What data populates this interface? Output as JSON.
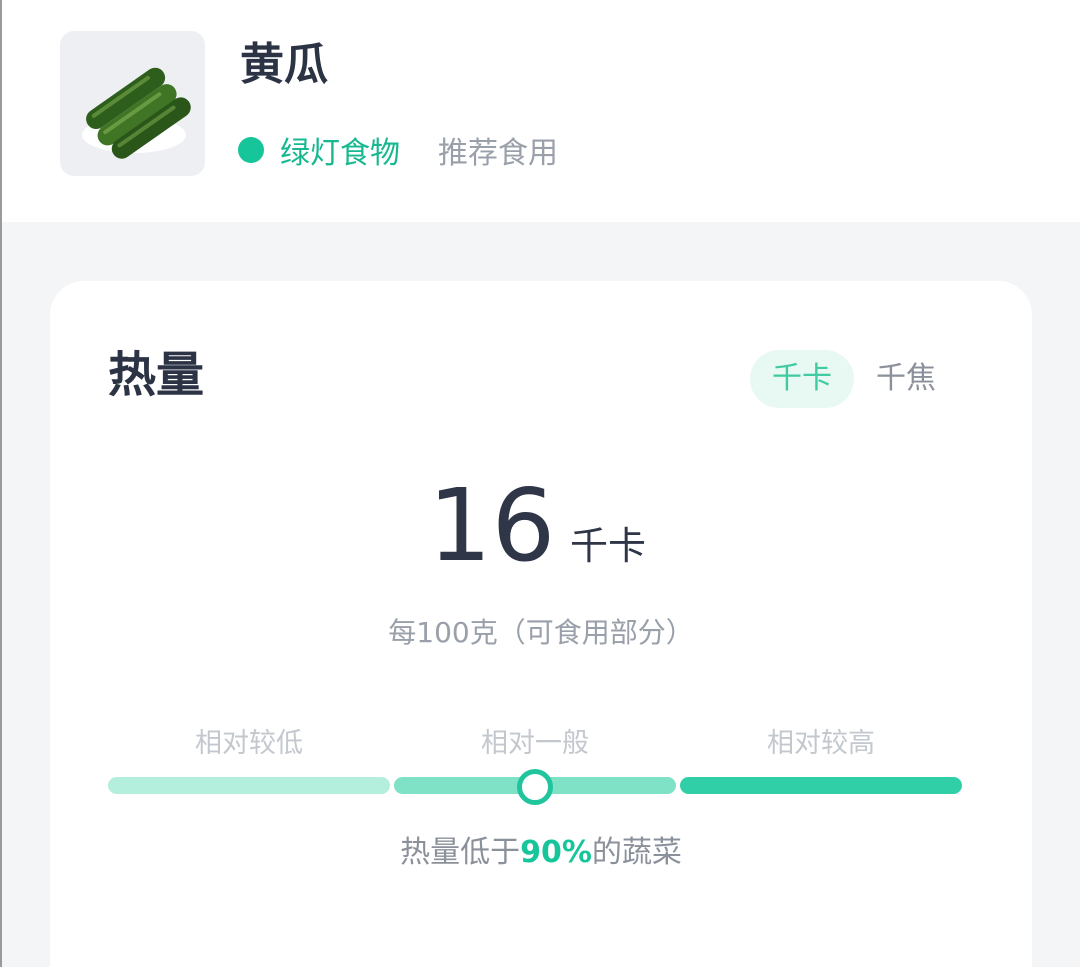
{
  "food": {
    "name": "黄瓜",
    "image_icon": "cucumber-photo",
    "tag_label": "绿灯食物",
    "tag_desc": "推荐食用",
    "tag_color": "#17c59a"
  },
  "energy": {
    "title": "热量",
    "units": [
      {
        "label": "千卡",
        "active": true
      },
      {
        "label": "千焦",
        "active": false
      }
    ],
    "value": "16",
    "unit_label": "千卡",
    "per_note": "每100克（可食用部分）",
    "levels": [
      {
        "label": "相对较低",
        "color": "#b4eedd"
      },
      {
        "label": "相对一般",
        "color": "#7fe1c5"
      },
      {
        "label": "相对较高",
        "color": "#31cfa7"
      }
    ],
    "marker_position_fraction": 0.5,
    "compare_prefix": "热量低于",
    "compare_pct": "90%",
    "compare_suffix": "的蔬菜"
  }
}
